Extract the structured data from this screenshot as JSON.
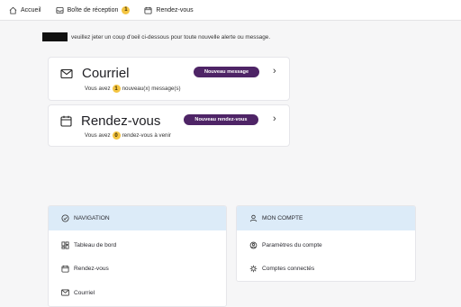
{
  "topnav": {
    "items": [
      {
        "label": "Accueil",
        "icon": "home-icon"
      },
      {
        "label": "Boîte de réception",
        "icon": "inbox-icon",
        "badge": "1"
      },
      {
        "label": "Rendez-vous",
        "icon": "calendar-icon"
      }
    ]
  },
  "welcome": {
    "text": "veuillez jeter un coup d'oeil ci-dessous pour toute nouvelle alerte ou message."
  },
  "cards": {
    "mail": {
      "icon": "envelope-icon",
      "title": "Courriel",
      "pill": "Nouveau message",
      "sub_prefix": "Vous avez",
      "count": "1",
      "sub_suffix": "nouveau(x) message(s)"
    },
    "rdv": {
      "icon": "calendar-icon",
      "title": "Rendez-vous",
      "pill": "Nouveau rendez-vous",
      "sub_prefix": "Vous avez",
      "count": "0",
      "sub_suffix": "rendez-vous à venir"
    }
  },
  "navigation_panel": {
    "title": "NAVIGATION",
    "links": [
      {
        "label": "Tableau de bord",
        "icon": "dashboard-icon"
      },
      {
        "label": "Rendez-vous",
        "icon": "calendar-icon"
      },
      {
        "label": "Courriel",
        "icon": "envelope-icon"
      }
    ]
  },
  "account_panel": {
    "title": "MON COMPTE",
    "links": [
      {
        "label": "Paramètres du compte",
        "icon": "settings-icon"
      },
      {
        "label": "Comptes connectés",
        "icon": "connected-accounts-icon"
      }
    ]
  },
  "colors": {
    "pill_bg": "#4e2466",
    "badge_bg": "#f4c542",
    "panel_header_bg": "#dcebf8"
  }
}
